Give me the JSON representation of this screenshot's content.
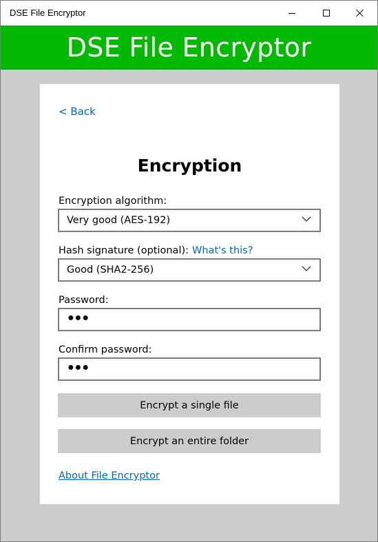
{
  "window": {
    "title": "DSE File Encryptor"
  },
  "banner": {
    "title": "DSE File Encryptor",
    "color": "#00b900"
  },
  "card": {
    "back_label": "< Back",
    "heading": "Encryption",
    "algorithm": {
      "label": "Encryption algorithm:",
      "selected": "Very good (AES-192)"
    },
    "hash": {
      "label": "Hash signature (optional):",
      "help_link": "What's this?",
      "selected": "Good (SHA2-256)"
    },
    "password": {
      "label": "Password:",
      "masked_value": "●●●"
    },
    "confirm_password": {
      "label": "Confirm password:",
      "masked_value": "●●●"
    },
    "encrypt_file_label": "Encrypt a single file",
    "encrypt_folder_label": "Encrypt an entire folder",
    "about_label": "About File Encryptor"
  },
  "colors": {
    "accent_link": "#0067c0",
    "button_bg": "#cccccc",
    "window_bg": "#cccccc"
  },
  "icons": {
    "minimize": "minimize-icon",
    "maximize": "maximize-icon",
    "close": "close-icon",
    "dropdown": "chevron-down-icon"
  }
}
